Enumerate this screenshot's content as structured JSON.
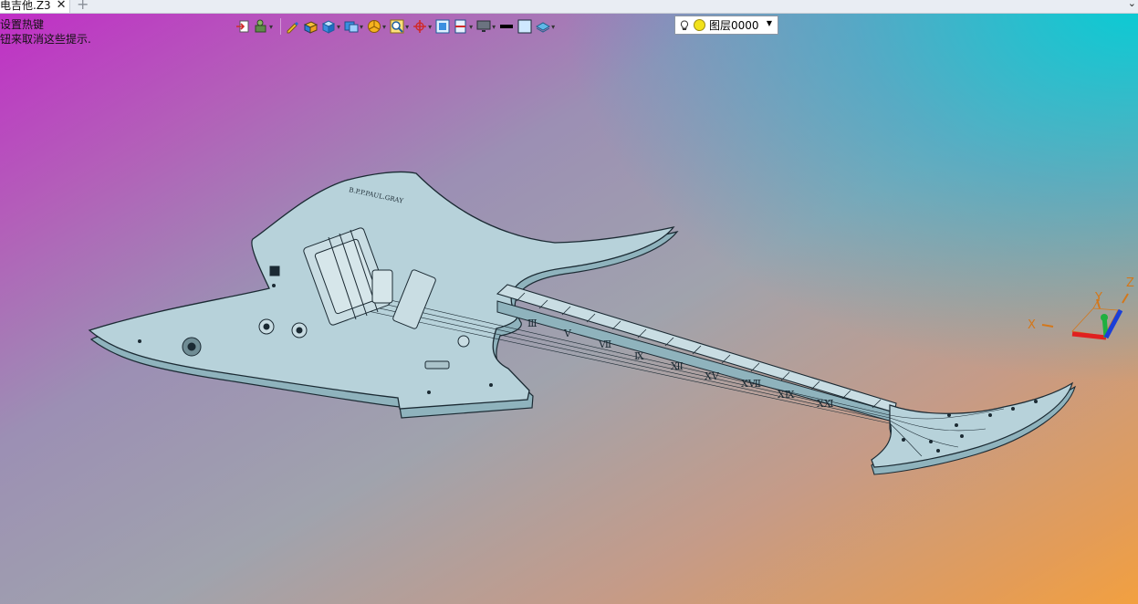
{
  "tab": {
    "title": "电吉他.Z3",
    "close": "✕",
    "new": "+"
  },
  "window": {
    "collapse": "⌄"
  },
  "hint": {
    "line1": "设置热键",
    "line2": "钮来取消这些提示."
  },
  "toolbar": {
    "items": [
      {
        "icon": "exit-sketch-icon"
      },
      {
        "icon": "move-tool-icon"
      },
      {
        "icon": "pen-tool-icon"
      },
      {
        "icon": "box-solid-icon"
      },
      {
        "icon": "view-cube-icon"
      },
      {
        "icon": "render-mode-icon"
      },
      {
        "icon": "pie-filter-icon"
      },
      {
        "icon": "zoom-icon"
      },
      {
        "icon": "rotate-axis-icon"
      },
      {
        "icon": "fit-view-icon"
      },
      {
        "icon": "section-view-icon"
      },
      {
        "icon": "display-monitor-icon"
      },
      {
        "icon": "line-style-icon"
      },
      {
        "icon": "color-swatch-icon"
      },
      {
        "icon": "layer-stack-icon"
      }
    ]
  },
  "layer": {
    "value": "图层0000",
    "icon": "lightbulb-icon"
  },
  "model": {
    "headstock_text": "B.P.P.PAUL.GRAY",
    "fret_marks": [
      "Ⅲ",
      "Ⅴ",
      "Ⅶ",
      "Ⅸ",
      "Ⅻ",
      "ⅩⅤ",
      "ⅩⅦ",
      "ⅩⅨ",
      "ⅩⅪ"
    ]
  },
  "triad": {
    "x_label": "X",
    "y_label": "Y",
    "z_label": "Z"
  },
  "colors": {
    "body": "#b7d2da",
    "outline": "#1b2a33",
    "x_axis": "#e02020",
    "y_axis": "#20b040",
    "z_axis": "#1a3fd8",
    "axis_label": "#d4771a"
  }
}
